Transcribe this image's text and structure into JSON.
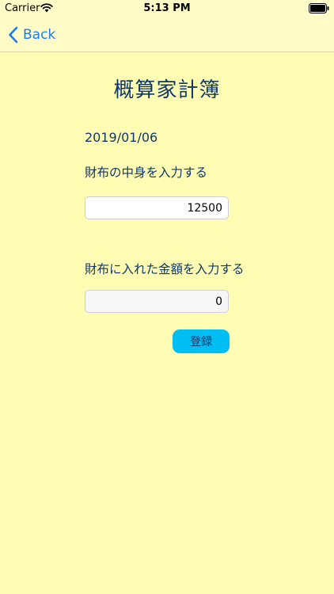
{
  "status_bar": {
    "carrier": "Carrier",
    "time": "5:13 PM",
    "wifi_icon": "wifi-icon",
    "battery_icon": "battery-full-icon"
  },
  "nav": {
    "back_label": "Back",
    "back_icon": "chevron-left-icon",
    "accent_color": "#1A7CF5"
  },
  "main": {
    "title": "概算家計簿",
    "date": "2019/01/06",
    "wallet_label": "財布の中身を入力する",
    "wallet_value": "12500",
    "added_label": "財布に入れた金額を入力する",
    "added_value": "0",
    "register_label": "登録"
  },
  "colors": {
    "background": "#FFFDB3",
    "bar_background": "#FFFCC7",
    "text": "#0F3768",
    "button": "#00BDF2"
  }
}
